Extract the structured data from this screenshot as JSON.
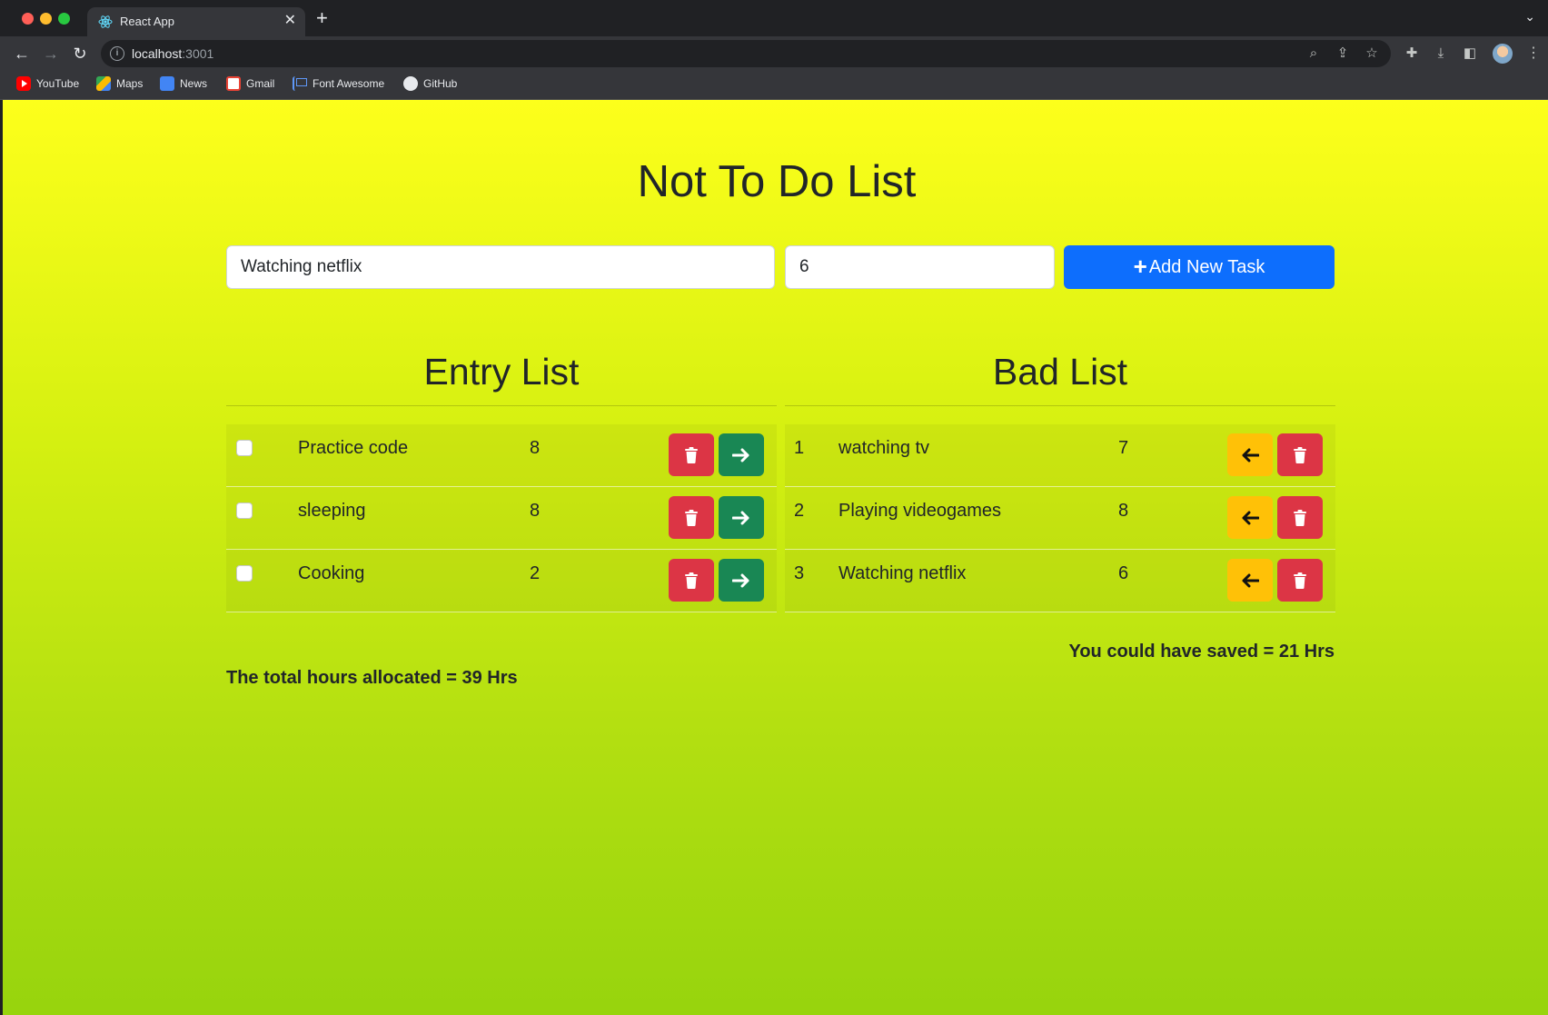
{
  "browser": {
    "tab_title": "React App",
    "url_host": "localhost",
    "url_port": ":3001",
    "bookmarks": [
      {
        "label": "YouTube",
        "icon": "youtube-icon"
      },
      {
        "label": "Maps",
        "icon": "maps-icon"
      },
      {
        "label": "News",
        "icon": "news-icon"
      },
      {
        "label": "Gmail",
        "icon": "gmail-icon"
      },
      {
        "label": "Font Awesome",
        "icon": "flag-icon"
      },
      {
        "label": "GitHub",
        "icon": "github-icon"
      }
    ]
  },
  "app": {
    "title": "Not To Do List",
    "form": {
      "task_value": "Watching netflix",
      "hours_value": "6",
      "add_button_label": "Add New Task"
    },
    "entry_list": {
      "title": "Entry List",
      "rows": [
        {
          "task": "Practice code",
          "hours": "8"
        },
        {
          "task": "sleeping",
          "hours": "8"
        },
        {
          "task": "Cooking",
          "hours": "2"
        }
      ]
    },
    "bad_list": {
      "title": "Bad List",
      "rows": [
        {
          "num": "1",
          "task": "watching tv",
          "hours": "7"
        },
        {
          "num": "2",
          "task": "Playing videogames",
          "hours": "8"
        },
        {
          "num": "3",
          "task": "Watching netflix",
          "hours": "6"
        }
      ]
    },
    "saved_text": "You could have saved = 21 Hrs",
    "total_text": "The total hours allocated = 39 Hrs"
  },
  "colors": {
    "primary": "#0d6efd",
    "danger": "#dc3545",
    "success": "#198754",
    "warning": "#ffc107",
    "background_top": "#fdff1b",
    "background_bottom": "#97d40d"
  }
}
